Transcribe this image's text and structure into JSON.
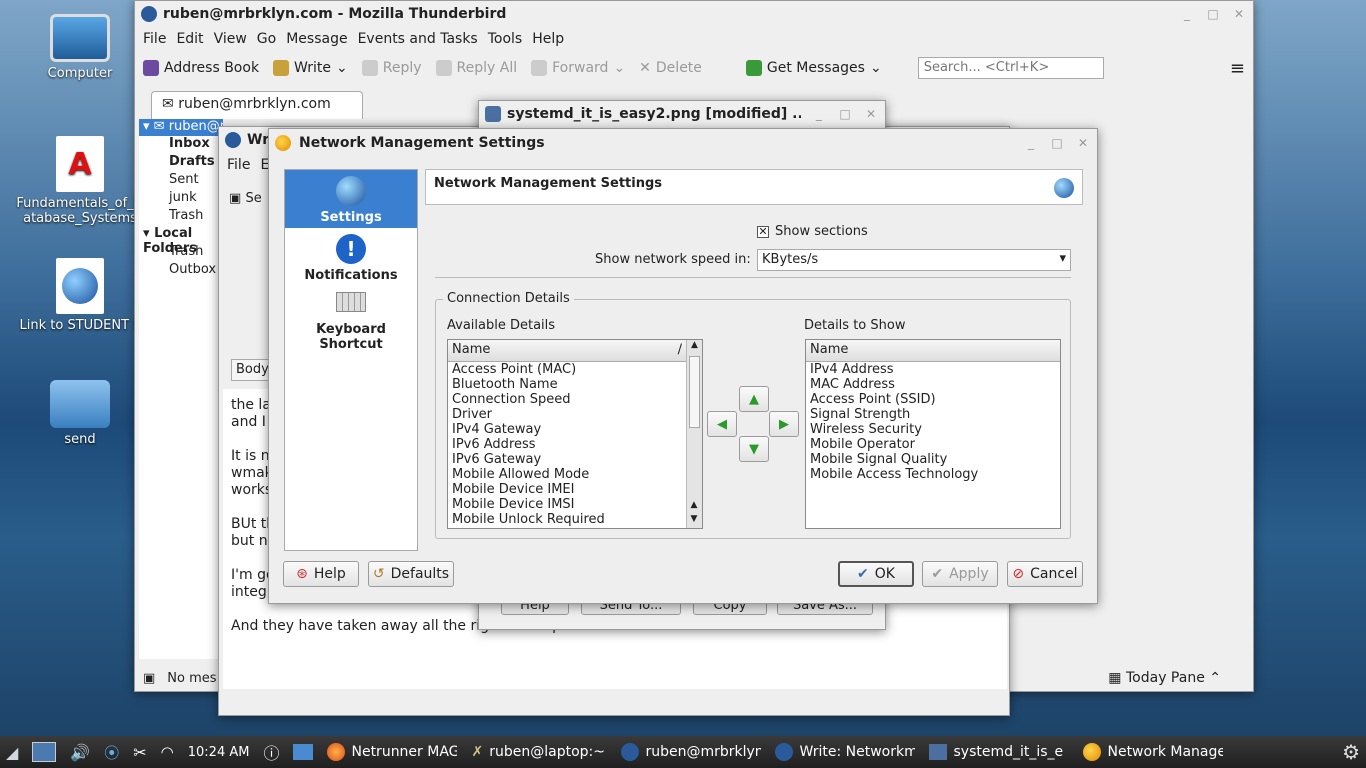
{
  "desktop": {
    "icons": [
      {
        "label": "Computer"
      },
      {
        "label": "Fundamentals_of_Database_Systems"
      },
      {
        "label": "Link to STUDENT L"
      },
      {
        "label": "send"
      }
    ]
  },
  "thunderbird": {
    "title": "ruben@mrbrklyn.com - Mozilla Thunderbird",
    "menu": [
      "File",
      "Edit",
      "View",
      "Go",
      "Message",
      "Events and Tasks",
      "Tools",
      "Help"
    ],
    "toolbar": {
      "address_book": "Address Book",
      "write": "Write",
      "reply": "Reply",
      "reply_all": "Reply All",
      "forward": "Forward",
      "delete": "Delete",
      "get_messages": "Get Messages"
    },
    "search_placeholder": "Search... <Ctrl+K>",
    "tab_label": "ruben@mrbrklyn.com",
    "folders": [
      "ruben@mrbrklyn.com",
      "Inbox",
      "Drafts",
      "Sent",
      "junk",
      "Trash",
      "Local Folders",
      "Trash",
      "Outbox"
    ],
    "status_text": "No mes",
    "today_pane": "Today Pane"
  },
  "compose": {
    "title": "Wr",
    "menu": [
      "File",
      "E"
    ],
    "send_label": "Se",
    "body_format": "Body",
    "body_lines": [
      "the la",
      "and I",
      "It is no",
      "wmak",
      "works",
      "BUt th",
      "but no",
      "I'm go",
      "integr",
      "And they have taken away all the right click options.  Look at this screen."
    ]
  },
  "image_window": {
    "title": "systemd_it_is_easy2.png [modified] ...",
    "buttons": [
      "Help",
      "Send To...",
      "Copy",
      "Save As..."
    ]
  },
  "dialog": {
    "title": "Network Management Settings",
    "sidebar": [
      {
        "label": "Settings"
      },
      {
        "label": "Notifications"
      },
      {
        "label": "Keyboard Shortcut"
      }
    ],
    "header_title": "Network Management Settings",
    "show_sections_label": "Show sections",
    "show_sections_checked": true,
    "speed_label": "Show network speed in:",
    "speed_value": "KBytes/s",
    "group_title": "Connection Details",
    "available_label": "Available Details",
    "show_label": "Details to Show",
    "column_name": "Name",
    "available": [
      "Access Point (MAC)",
      "Bluetooth Name",
      "Connection Speed",
      "Driver",
      "IPv4 Gateway",
      "IPv6 Address",
      "IPv6 Gateway",
      "Mobile Allowed Mode",
      "Mobile Device IMEI",
      "Mobile Device IMSI",
      "Mobile Unlock Required"
    ],
    "shown": [
      "IPv4 Address",
      "MAC Address",
      "Access Point (SSID)",
      "Signal Strength",
      "Wireless Security",
      "Mobile Operator",
      "Mobile Signal Quality",
      "Mobile Access Technology"
    ],
    "buttons": {
      "help": "Help",
      "defaults": "Defaults",
      "ok": "OK",
      "apply": "Apply",
      "cancel": "Cancel"
    }
  },
  "taskbar": {
    "clock": "10:24 AM",
    "tasks": [
      "Netrunner MAG",
      "ruben@laptop:~",
      "ruben@mrbrklyn",
      "Write: Networkm",
      "systemd_it_is_e",
      "Network Manage"
    ]
  },
  "colors": {
    "selection": "#3b7fd1",
    "accent_green": "#2a9a2a",
    "taskbar": "#2b2b2b"
  }
}
